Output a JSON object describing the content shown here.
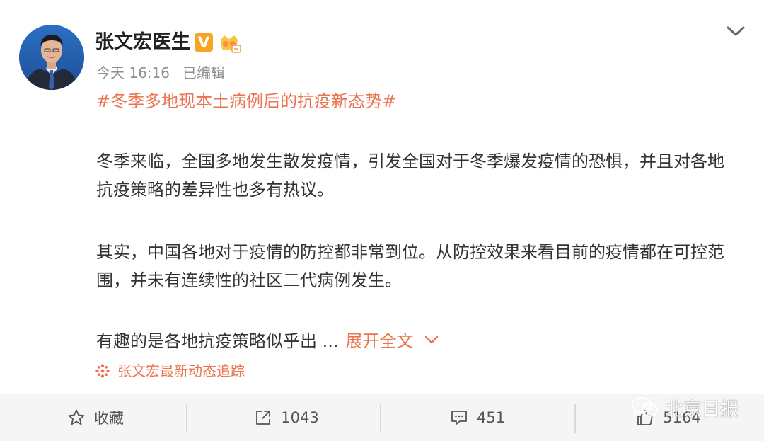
{
  "author": {
    "name": "张文宏医生",
    "verified_badge": "V",
    "accent_color": "#f5a623"
  },
  "meta": {
    "time": "今天 16:16",
    "edited": "已编辑"
  },
  "post": {
    "hashtag": "#冬季多地现本土病例后的抗疫新态势#",
    "paragraphs": [
      "冬季来临，全国多地发生散发疫情，引发全国对于冬季爆发疫情的恐惧，并且对各地抗疫策略的差异性也多有热议。",
      "其实，中国各地对于疫情的防控都非常到位。从防控效果来看目前的疫情都在可控范围，并未有连续性的社区二代病例发生。",
      "有趣的是各地抗疫策略似乎出 ..."
    ],
    "expand_label": "展开全文",
    "link_color": "#eb7350"
  },
  "tracker": {
    "label": "张文宏最新动态追踪"
  },
  "actions": {
    "favorite_label": "收藏",
    "repost_count": "1043",
    "comment_count": "451",
    "like_count": "5164"
  },
  "watermark": {
    "label": "北京日报"
  },
  "icons": {
    "avatar": "avatar-photo",
    "verified": "verified-v-icon",
    "member": "member-crown-icon",
    "menu": "chevron-down-icon",
    "tracker": "tracker-flower-icon",
    "favorite": "star-icon",
    "repost": "share-icon",
    "comment": "comment-icon",
    "like": "thumbs-up-icon",
    "watermark": "wechat-icon"
  }
}
